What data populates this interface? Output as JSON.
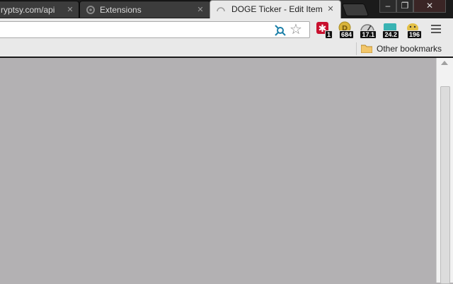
{
  "tabs": [
    {
      "title": "ryptsy.com/api",
      "close": "✕",
      "active": false
    },
    {
      "title": "Extensions",
      "close": "✕",
      "active": false
    },
    {
      "title": "DOGE Ticker - Edit Item",
      "close": "✕",
      "active": true
    }
  ],
  "window_controls": {
    "minimize": "–",
    "maximize": "❐",
    "close": "✕"
  },
  "omnibox": {
    "value": "",
    "placeholder": ""
  },
  "extensions": [
    {
      "icon": "lastpass-icon",
      "badge": "1",
      "color": "#c8102e"
    },
    {
      "icon": "doge-coin-icon",
      "badge": "684",
      "color": "#d8b33a"
    },
    {
      "icon": "gauge-icon",
      "badge": "17.1",
      "color": "#9a9a9a"
    },
    {
      "icon": "ticker-icon",
      "badge": "24.2",
      "color": "#39b3b3"
    },
    {
      "icon": "doge-face-icon",
      "badge": "196",
      "color": "#e3c047"
    }
  ],
  "bookmarks": {
    "other": "Other bookmarks"
  },
  "colors": {
    "content_bg": "#b3b1b3",
    "toolbar_bg": "#e9e9e9",
    "titlebar_bg": "#1b1b1b"
  }
}
